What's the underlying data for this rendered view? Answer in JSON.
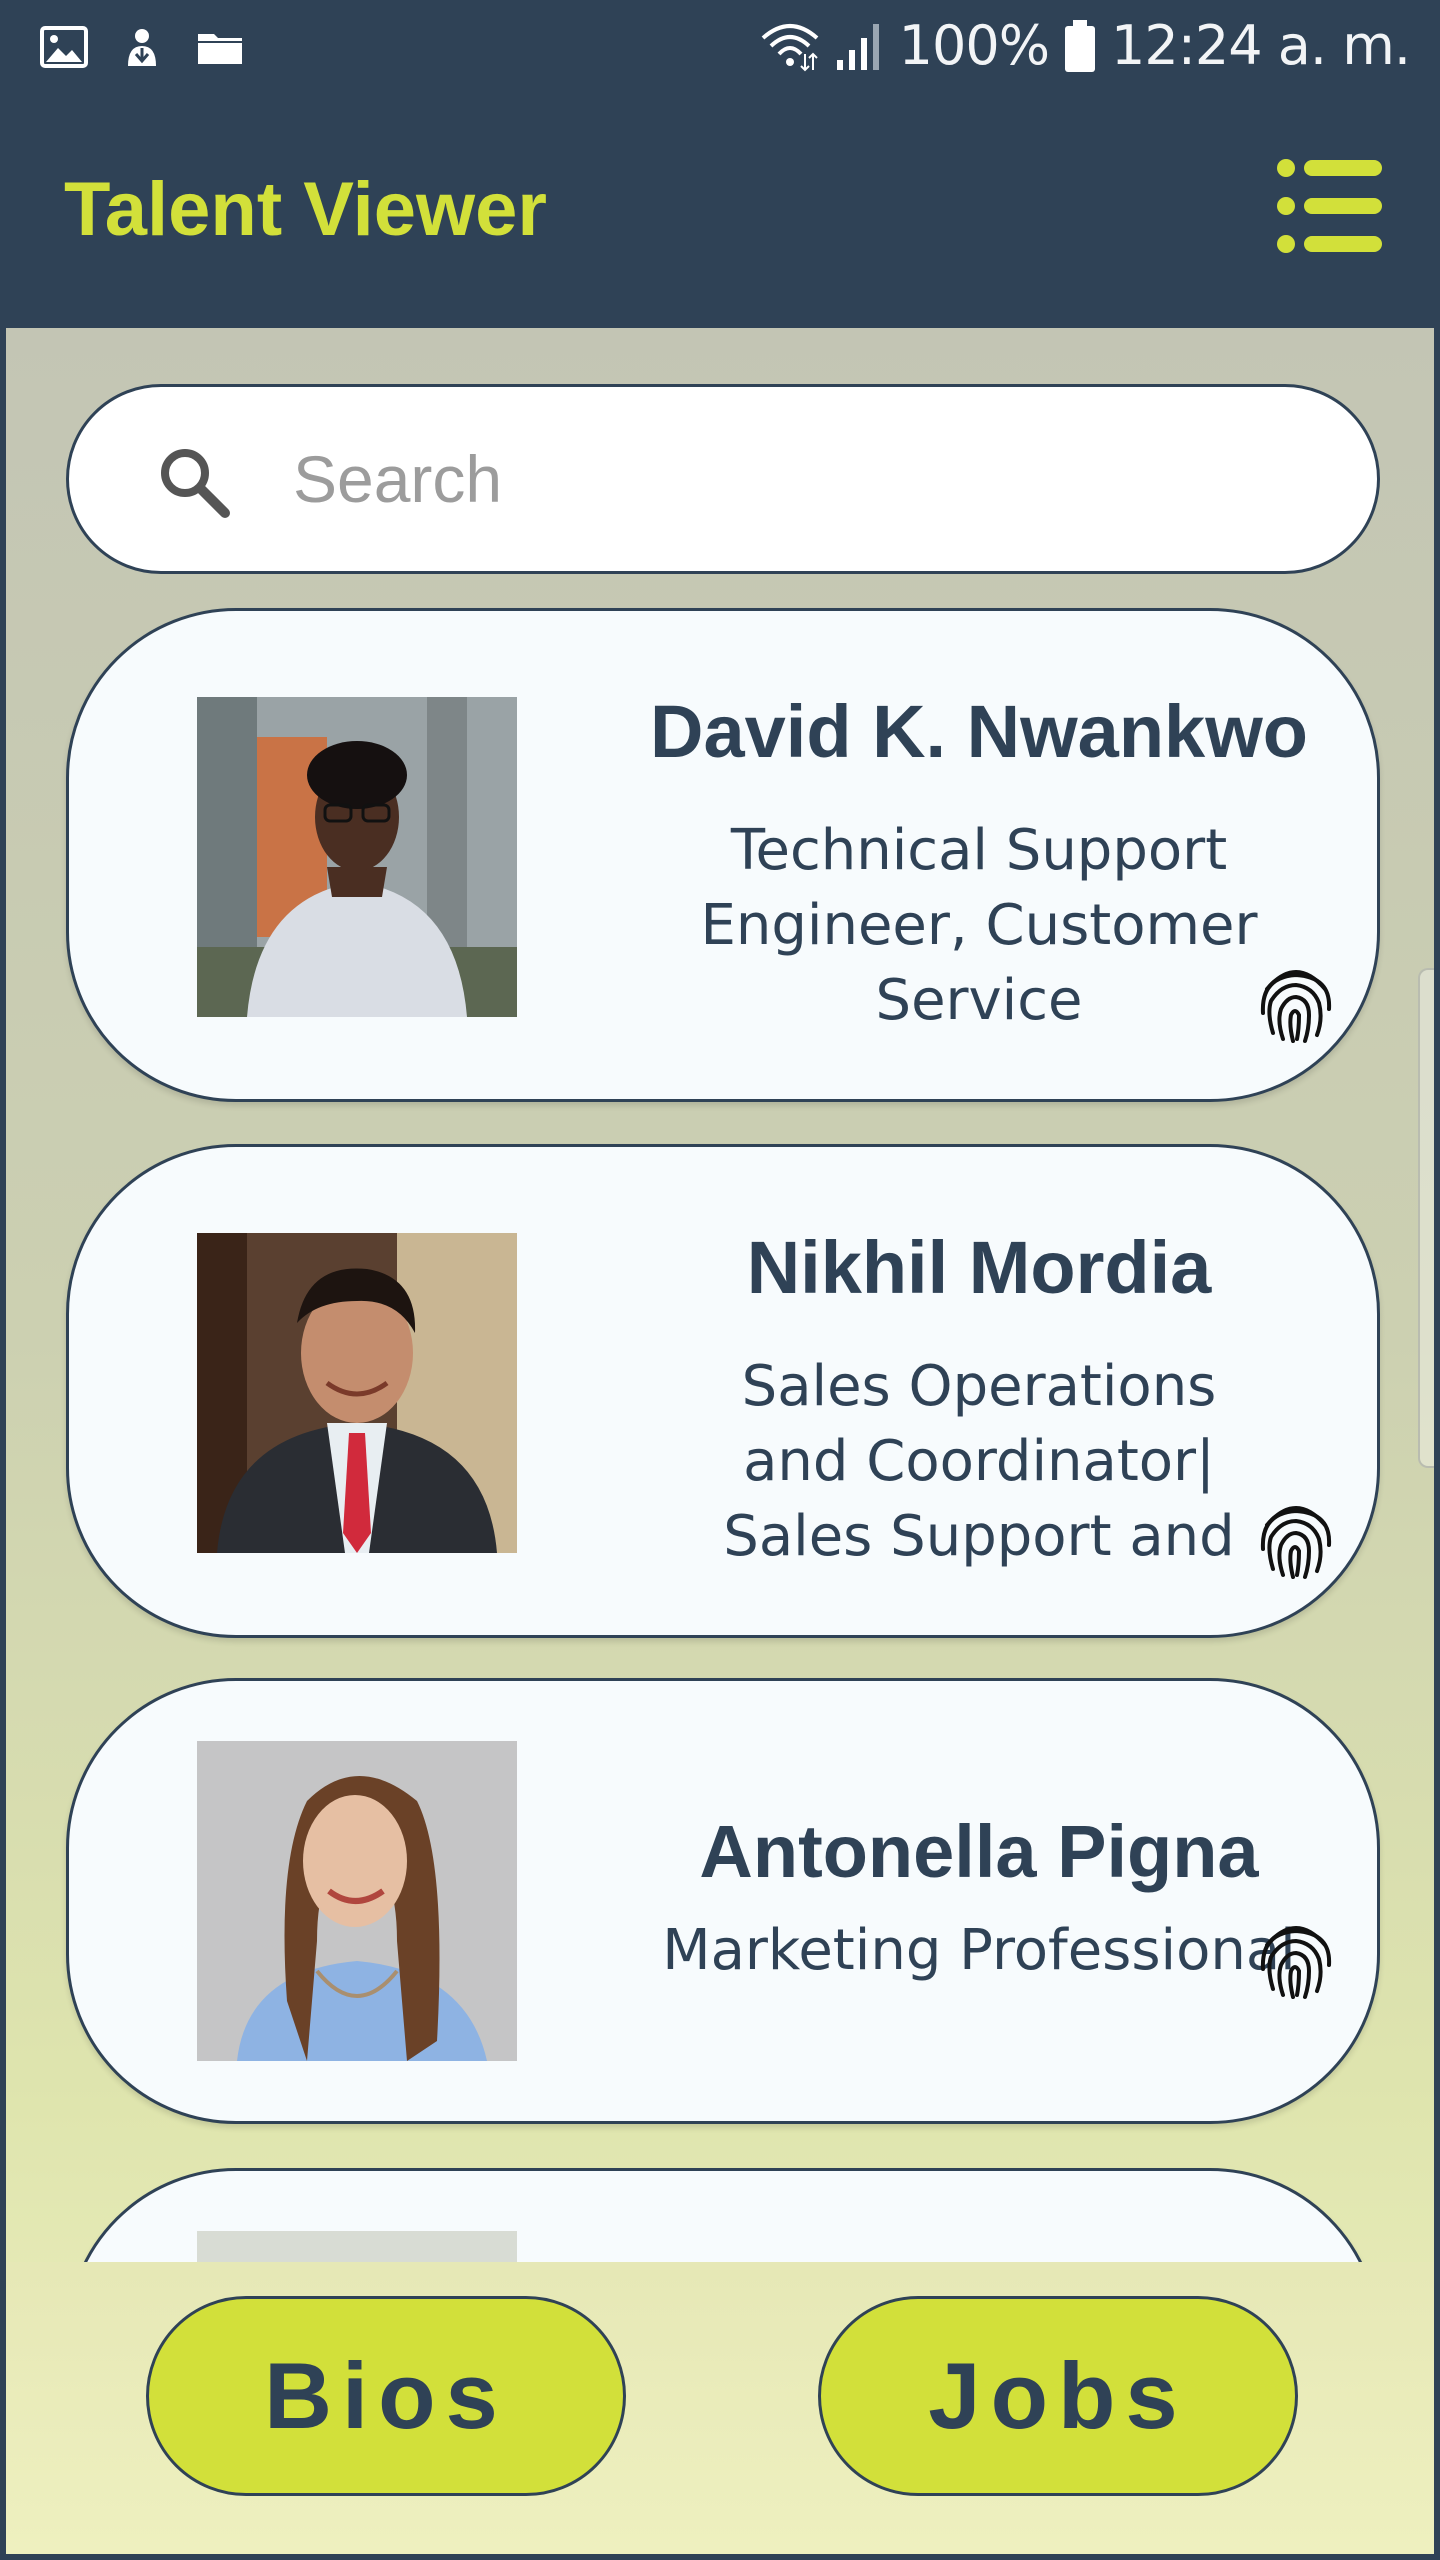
{
  "status_bar": {
    "battery": "100%",
    "time": "12:24 a. m.",
    "icons": [
      "image-icon",
      "download-icon",
      "folder-icon",
      "wifi-icon",
      "signal-icon",
      "battery-icon"
    ]
  },
  "app": {
    "title": "Talent Viewer",
    "menu_icon": "menu-icon",
    "accent_color": "#d2e03a",
    "brand_color": "#2f4256"
  },
  "search": {
    "placeholder": "Search",
    "value": ""
  },
  "cards": [
    {
      "name": "David K. Nwankwo",
      "role_lines": [
        "Technical Support",
        "Engineer, Customer",
        "Service"
      ]
    },
    {
      "name": "Nikhil Mordia",
      "role_lines": [
        "Sales Operations",
        "and Coordinator|",
        "Sales Support and"
      ]
    },
    {
      "name": "Antonella Pigna",
      "role_lines": [
        "Marketing Professional"
      ]
    }
  ],
  "bottom_nav": {
    "bios_label": "Bios",
    "jobs_label": "Jobs"
  }
}
